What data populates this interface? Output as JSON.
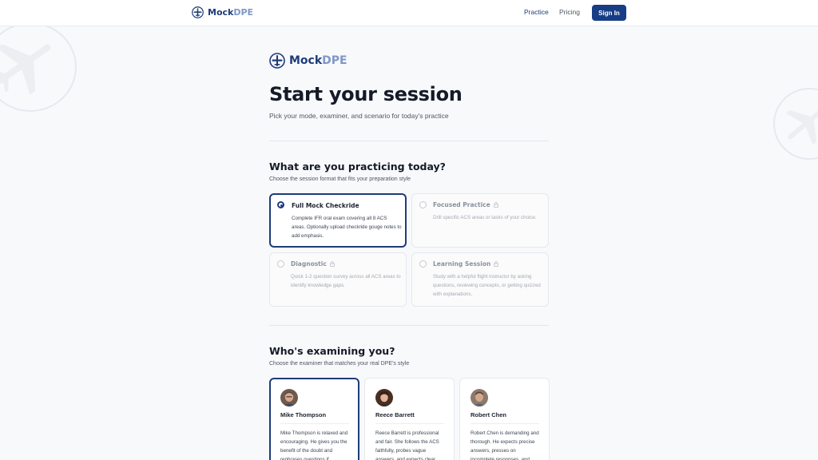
{
  "brand": {
    "mock": "Mock",
    "dpe": "DPE"
  },
  "nav": {
    "practice": "Practice",
    "pricing": "Pricing",
    "sign_in": "Sign In"
  },
  "header": {
    "title": "Start your session",
    "subtitle": "Pick your mode, examiner, and scenario for today's practice"
  },
  "format_section": {
    "title": "What are you practicing today?",
    "subtitle": "Choose the session format that fits your preparation style",
    "modes": [
      {
        "title": "Full Mock Checkride",
        "desc": "Complete IFR oral exam covering all 8 ACS areas. Optionally upload checkride gouge notes to add emphasis.",
        "selected": true,
        "locked": false
      },
      {
        "title": "Focused Practice",
        "desc": "Drill specific ACS areas or tasks of your choice.",
        "selected": false,
        "locked": true
      },
      {
        "title": "Diagnostic",
        "desc": "Quick 1-2 question survey across all ACS areas to identify knowledge gaps.",
        "selected": false,
        "locked": true
      },
      {
        "title": "Learning Session",
        "desc": "Study with a helpful flight instructor by asking questions, reviewing concepts, or getting quizzed with explanations.",
        "selected": false,
        "locked": true
      }
    ]
  },
  "examiner_section": {
    "title": "Who's examining you?",
    "subtitle": "Choose the examiner that matches your real DPE's style",
    "examiners": [
      {
        "name": "Mike Thompson",
        "desc": "Mike Thompson is relaxed and encouraging. He gives you the benefit of the doubt and rephrases questions if",
        "selected": true
      },
      {
        "name": "Reece Barrett",
        "desc": "Reece Barrett is professional and fair. She follows the ACS faithfully, probes vague answers, and expects clear",
        "selected": false
      },
      {
        "name": "Robert Chen",
        "desc": "Robert Chen is demanding and thorough. He expects precise answers, presses on incomplete responses, and",
        "selected": false
      }
    ]
  },
  "colors": {
    "accent": "#1d3c78",
    "accent_light": "#7f97c7",
    "button": "#163d86"
  },
  "icons": {
    "logo": "propeller-airplane-icon",
    "lock": "lock-icon",
    "background": "airplane-icon"
  }
}
